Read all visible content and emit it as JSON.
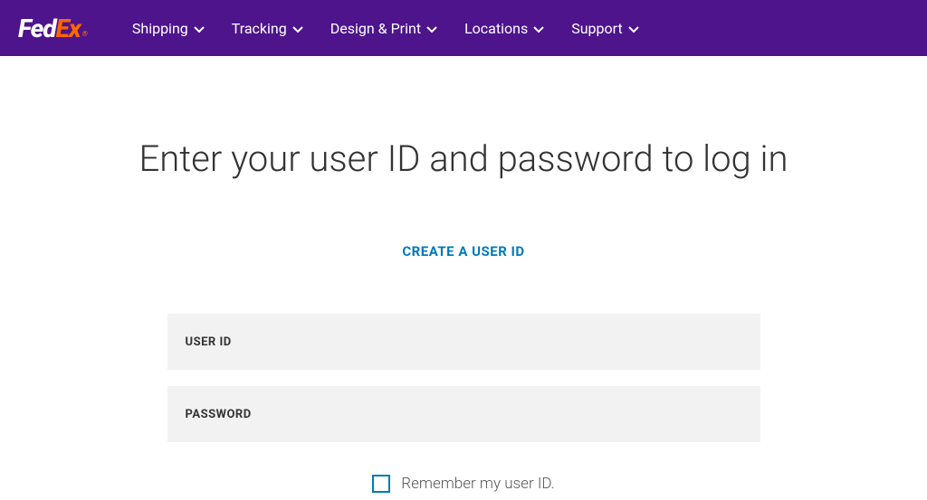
{
  "logo": {
    "part1": "Fed",
    "part2": "Ex"
  },
  "nav": {
    "items": [
      {
        "label": "Shipping"
      },
      {
        "label": "Tracking"
      },
      {
        "label": "Design & Print"
      },
      {
        "label": "Locations"
      },
      {
        "label": "Support"
      }
    ]
  },
  "main": {
    "title": "Enter your user ID and password to log in",
    "create_link": "CREATE A USER ID",
    "user_id_placeholder": "USER ID",
    "password_placeholder": "PASSWORD",
    "remember_label": "Remember my user ID."
  }
}
